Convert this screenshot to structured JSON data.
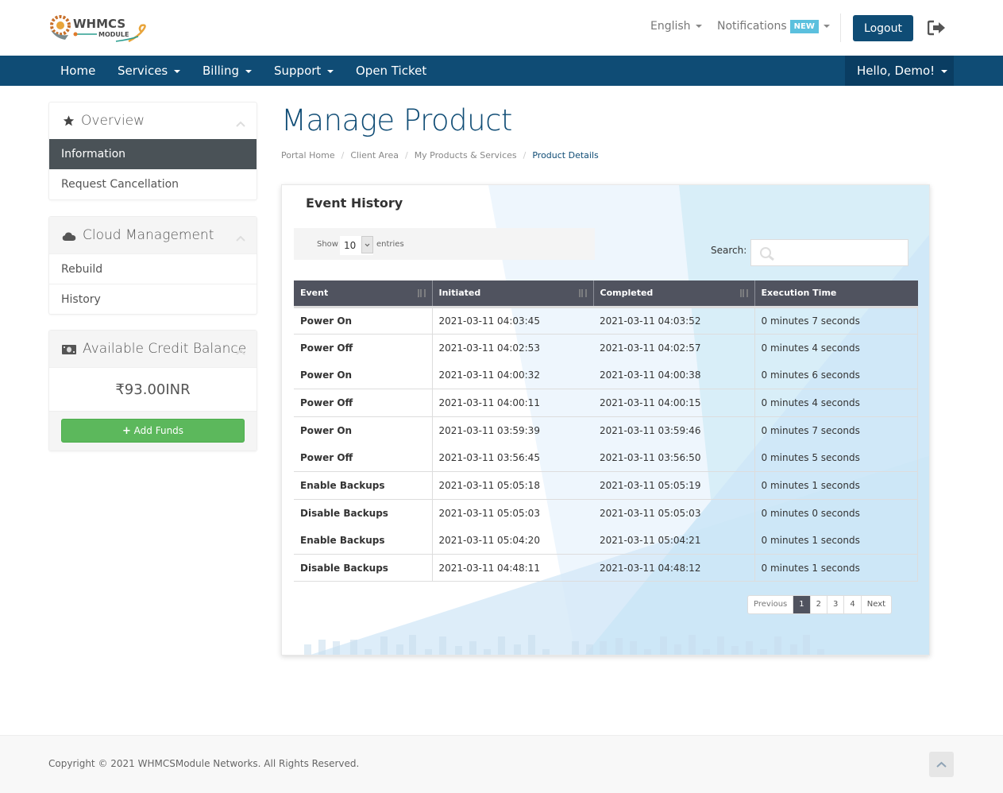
{
  "brand": {
    "logo_text_main": "WHMCS",
    "logo_text_sub": "MODULE"
  },
  "topbar": {
    "language_label": "English",
    "notifications_label": "Notifications",
    "notifications_badge": "NEW",
    "logout_label": "Logout",
    "exit_icon": "sign-out-icon"
  },
  "navbar": {
    "items": [
      {
        "label": "Home",
        "has_dropdown": false
      },
      {
        "label": "Services",
        "has_dropdown": true
      },
      {
        "label": "Billing",
        "has_dropdown": true
      },
      {
        "label": "Support",
        "has_dropdown": true
      },
      {
        "label": "Open Ticket",
        "has_dropdown": false
      }
    ],
    "user_label": "Hello, Demo!"
  },
  "sidebar": {
    "overview": {
      "title": "Overview",
      "icon": "star-icon",
      "items": [
        {
          "label": "Information",
          "active": true
        },
        {
          "label": "Request Cancellation",
          "active": false
        }
      ]
    },
    "cloud": {
      "title": "Cloud Management",
      "icon": "cloud-icon",
      "items": [
        {
          "label": "Rebuild"
        },
        {
          "label": "History"
        }
      ]
    },
    "credit": {
      "title": "Available Credit Balance",
      "icon": "money-icon",
      "amount": "₹93.00INR",
      "add_funds_label": "Add Funds"
    }
  },
  "main": {
    "title": "Manage Product",
    "breadcrumb": [
      {
        "label": "Portal Home"
      },
      {
        "label": "Client Area"
      },
      {
        "label": "My Products & Services"
      },
      {
        "label": "Product Details",
        "current": true
      }
    ],
    "event_history": {
      "title": "Event History",
      "show_label": "Show",
      "entries_label": "entries",
      "page_length": "10",
      "search_label": "Search:",
      "search_value": "",
      "columns": [
        "Event",
        "Initiated",
        "Completed",
        "Execution Time"
      ],
      "rows": [
        {
          "event": "Power On",
          "initiated": "2021-03-11 04:03:45",
          "completed": "2021-03-11 04:03:52",
          "execution": "0 minutes 7 seconds"
        },
        {
          "event": "Power Off",
          "initiated": "2021-03-11 04:02:53",
          "completed": "2021-03-11 04:02:57",
          "execution": "0 minutes 4 seconds"
        },
        {
          "event": "Power On",
          "initiated": "2021-03-11 04:00:32",
          "completed": "2021-03-11 04:00:38",
          "execution": "0 minutes 6 seconds"
        },
        {
          "event": "Power Off",
          "initiated": "2021-03-11 04:00:11",
          "completed": "2021-03-11 04:00:15",
          "execution": "0 minutes 4 seconds"
        },
        {
          "event": "Power On",
          "initiated": "2021-03-11 03:59:39",
          "completed": "2021-03-11 03:59:46",
          "execution": "0 minutes 7 seconds"
        },
        {
          "event": "Power Off",
          "initiated": "2021-03-11 03:56:45",
          "completed": "2021-03-11 03:56:50",
          "execution": "0 minutes 5 seconds"
        },
        {
          "event": "Enable Backups",
          "initiated": "2021-03-11 05:05:18",
          "completed": "2021-03-11 05:05:19",
          "execution": "0 minutes 1 seconds"
        },
        {
          "event": "Disable Backups",
          "initiated": "2021-03-11 05:05:03",
          "completed": "2021-03-11 05:05:03",
          "execution": "0 minutes 0 seconds"
        },
        {
          "event": "Enable Backups",
          "initiated": "2021-03-11 05:04:20",
          "completed": "2021-03-11 05:04:21",
          "execution": "0 minutes 1 seconds"
        },
        {
          "event": "Disable Backups",
          "initiated": "2021-03-11 04:48:11",
          "completed": "2021-03-11 04:48:12",
          "execution": "0 minutes 1 seconds"
        }
      ],
      "pagination": {
        "previous_label": "Previous",
        "next_label": "Next",
        "pages": [
          "1",
          "2",
          "3",
          "4"
        ],
        "current_page": "1"
      }
    }
  },
  "footer": {
    "copyright": "Copyright © 2021 WHMCSModule Networks. All Rights Reserved."
  },
  "colors": {
    "brand_primary": "#0f4c75",
    "navbar_user_bg": "#0a3d62",
    "sidebar_active_bg": "#4a5257",
    "table_header_bg": "#50535f",
    "success": "#5cb85c",
    "badge_info": "#5bc0de"
  }
}
